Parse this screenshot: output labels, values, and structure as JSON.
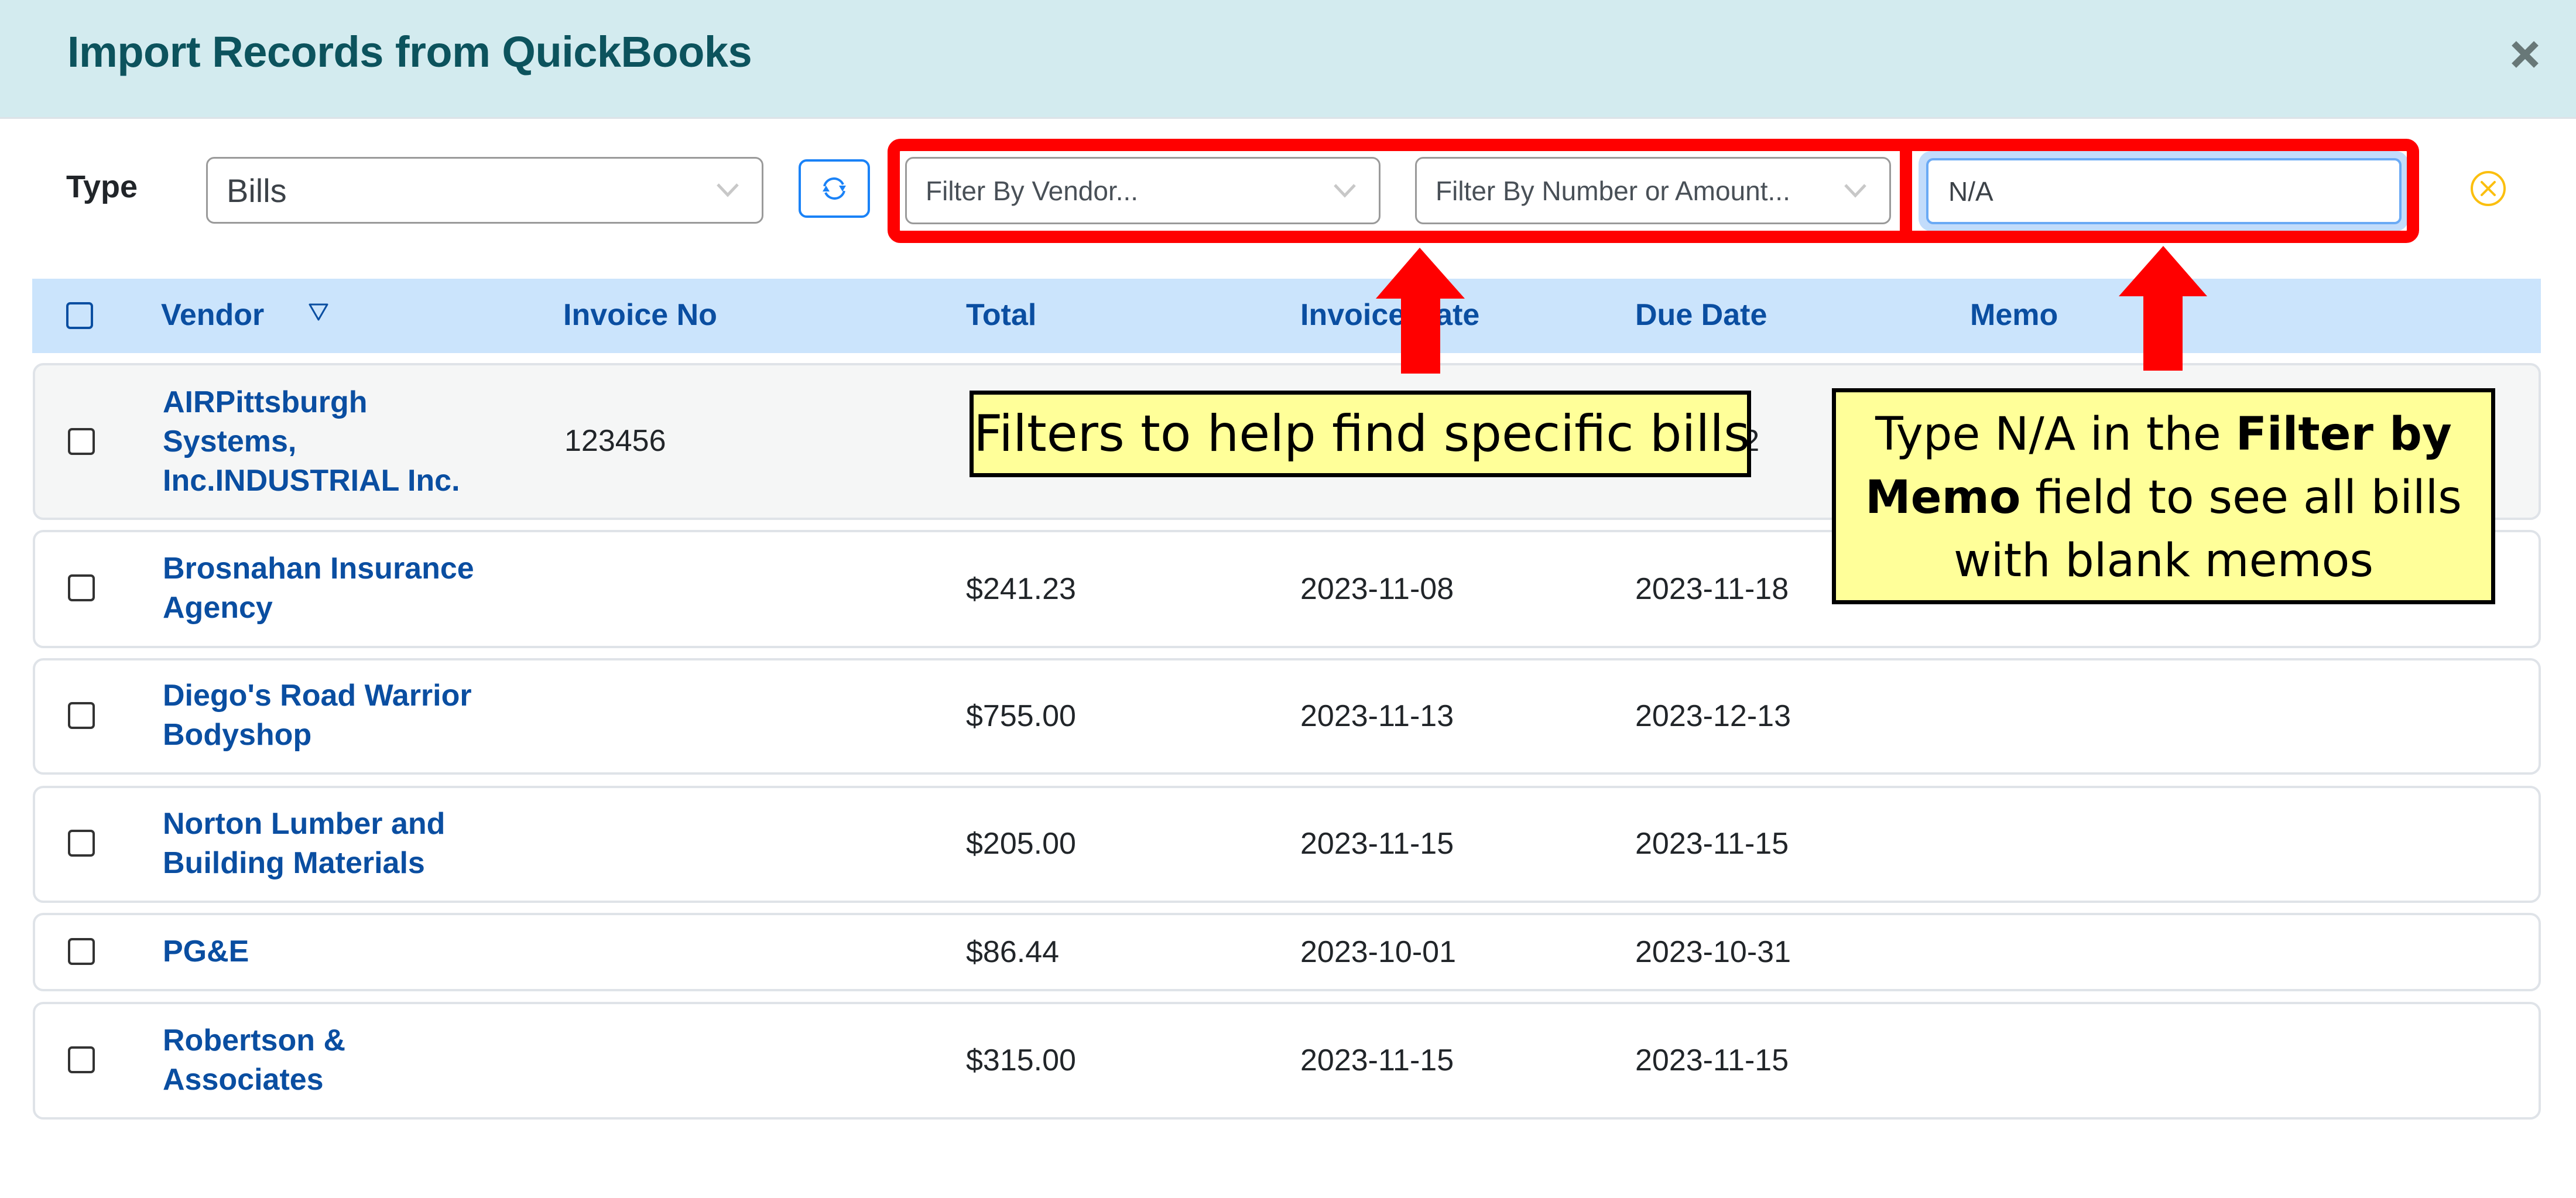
{
  "dialog": {
    "title": "Import Records from QuickBooks",
    "close_icon": "close-x-icon"
  },
  "toolbar": {
    "type_label": "Type",
    "type_value": "Bills",
    "refresh_icon": "refresh-icon",
    "vendor_filter_placeholder": "Filter By Vendor...",
    "number_filter_placeholder": "Filter By Number or Amount...",
    "memo_filter_value": "N/A",
    "clear_icon": "clear-circle-x-icon"
  },
  "colors": {
    "header_bg": "#d3ebef",
    "title": "#0c535d",
    "table_header_bg": "#cbe4fc",
    "link": "#0a4ea1",
    "highlight_red": "#ff0000",
    "note_bg": "#ffff99",
    "clear_icon": "#fbbf0f",
    "refresh": "#1a82f7"
  },
  "table": {
    "columns": [
      "Vendor",
      "Invoice No",
      "Total",
      "Invoice Date",
      "Due Date",
      "Memo"
    ],
    "sort_icon": "sort-triangle-down-icon",
    "rows": [
      {
        "vendor": [
          "AIRPittsburgh",
          "Systems,",
          "Inc.INDUSTRIAL Inc."
        ],
        "invoice_no": "123456",
        "total": "",
        "invoice_date": "",
        "due_date": "-12",
        "memo": ""
      },
      {
        "vendor": [
          "Brosnahan Insurance",
          "Agency"
        ],
        "invoice_no": "",
        "total": "$241.23",
        "invoice_date": "2023-11-08",
        "due_date": "2023-11-18",
        "memo": ""
      },
      {
        "vendor": [
          "Diego's Road Warrior",
          "Bodyshop"
        ],
        "invoice_no": "",
        "total": "$755.00",
        "invoice_date": "2023-11-13",
        "due_date": "2023-12-13",
        "memo": ""
      },
      {
        "vendor": [
          "Norton Lumber and",
          "Building Materials"
        ],
        "invoice_no": "",
        "total": "$205.00",
        "invoice_date": "2023-11-15",
        "due_date": "2023-11-15",
        "memo": ""
      },
      {
        "vendor": [
          "PG&E"
        ],
        "invoice_no": "",
        "total": "$86.44",
        "invoice_date": "2023-10-01",
        "due_date": "2023-10-31",
        "memo": ""
      },
      {
        "vendor": [
          "Robertson &",
          "Associates"
        ],
        "invoice_no": "",
        "total": "$315.00",
        "invoice_date": "2023-11-15",
        "due_date": "2023-11-15",
        "memo": ""
      }
    ]
  },
  "annotations": {
    "filters_note": "Filters to help find specific bills",
    "memo_note": {
      "part1": "Type N/A in the ",
      "bold1": "Filter by Memo",
      "part2": " field to see all bills with blank memos"
    }
  }
}
